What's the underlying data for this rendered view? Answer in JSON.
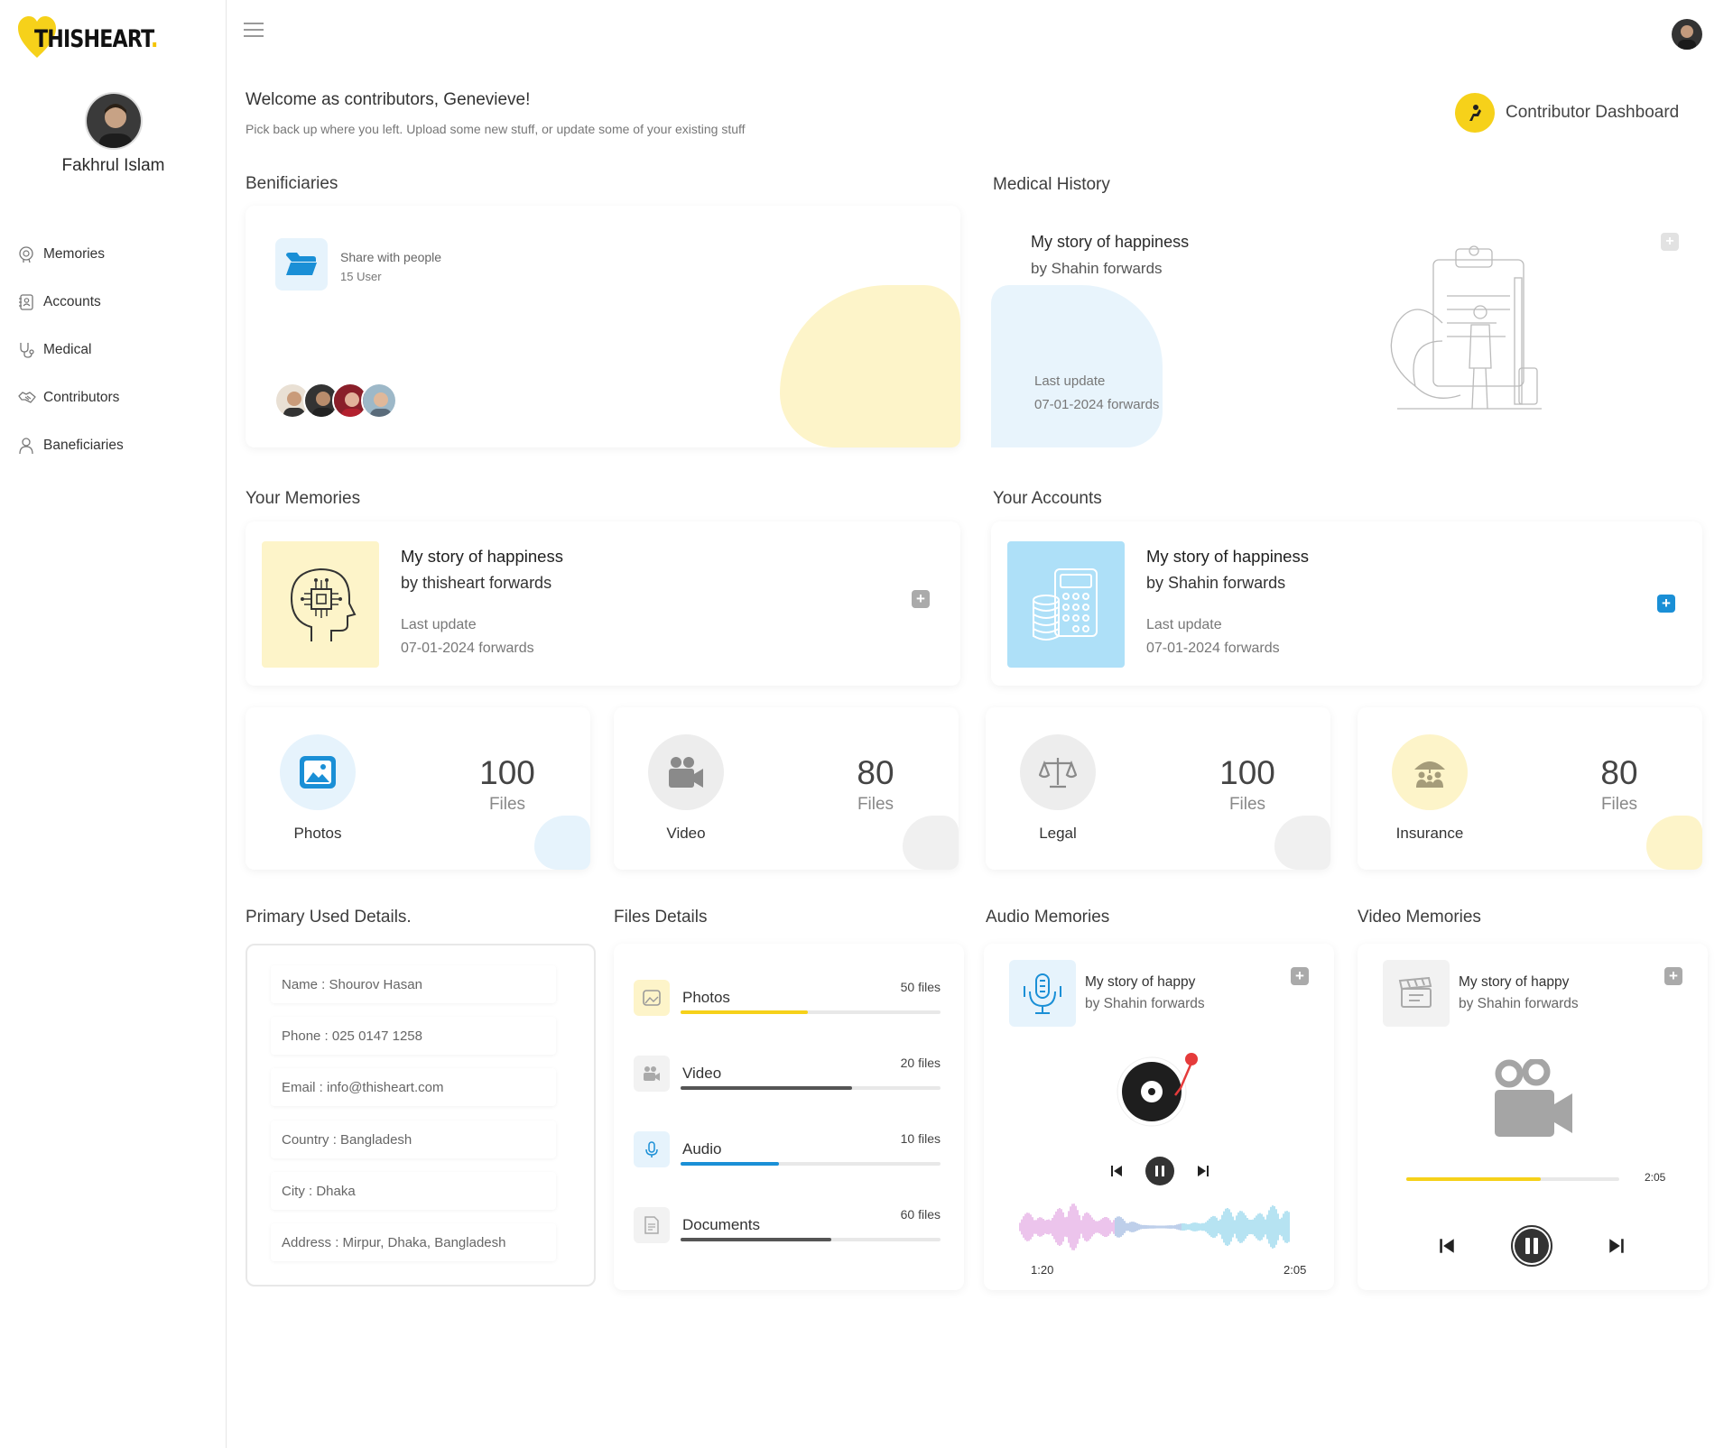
{
  "brand": {
    "name": "THISHEART",
    "accent": "#f6d11a"
  },
  "user": {
    "name": "Fakhrul Islam"
  },
  "nav": [
    {
      "label": "Memories",
      "icon": "brain-icon"
    },
    {
      "label": "Accounts",
      "icon": "contacts-book-icon"
    },
    {
      "label": "Medical",
      "icon": "stethoscope-icon"
    },
    {
      "label": "Contributors",
      "icon": "handshake-icon"
    },
    {
      "label": "Baneficiaries",
      "icon": "user-icon"
    }
  ],
  "welcome": {
    "title": "Welcome as contributors, Genevieve!",
    "subtitle": "Pick back up where you left. Upload some new stuff, or update some of your existing stuff"
  },
  "dashboard_label": "Contributor Dashboard",
  "sections": {
    "beneficiaries": "Benificiaries",
    "medical": "Medical History",
    "memories": "Your Memories",
    "accounts": "Your Accounts",
    "primary": "Primary Used  Details.",
    "files": "Files Details",
    "audio": "Audio Memories",
    "video": "Video Memories"
  },
  "beneficiaries": {
    "share": "Share with people",
    "users": "15 User"
  },
  "medical": {
    "title": "My story of happiness",
    "by": "by Shahin forwards",
    "last_label": "Last update",
    "date": "07-01-2024 forwards"
  },
  "memories_card": {
    "title": "My story of happiness",
    "by": "by thisheart forwards",
    "last_label": "Last update",
    "date": "07-01-2024 forwards"
  },
  "accounts_card": {
    "title": "My story of happiness",
    "by": "by Shahin forwards",
    "last_label": "Last update",
    "date": "07-01-2024 forwards"
  },
  "stats": [
    {
      "name": "Photos",
      "count": "100",
      "unit": "Files"
    },
    {
      "name": "Video",
      "count": "80",
      "unit": "Files"
    },
    {
      "name": "Legal",
      "count": "100",
      "unit": "Files"
    },
    {
      "name": "Insurance",
      "count": "80",
      "unit": "Files"
    }
  ],
  "primary": [
    "Name : Shourov Hasan",
    "Phone : 025 0147 1258",
    "Email : info@thisheart.com",
    "Country : Bangladesh",
    "City : Dhaka",
    "Address : Mirpur, Dhaka, Bangladesh"
  ],
  "files": [
    {
      "name": "Photos",
      "count": "50 files",
      "progress": 0.49,
      "color": "#f6d11a"
    },
    {
      "name": "Video",
      "count": "20 files",
      "progress": 0.66,
      "color": "#555555"
    },
    {
      "name": "Audio",
      "count": "10 files",
      "progress": 0.38,
      "color": "#1a8fd6"
    },
    {
      "name": "Documents",
      "count": "60 files",
      "progress": 0.58,
      "color": "#555555"
    }
  ],
  "audio": {
    "title": "My story of happy",
    "by": "by Shahin forwards",
    "current": "1:20",
    "total": "2:05"
  },
  "video": {
    "title": "My story of happy",
    "by": "by Shahin forwards",
    "total": "2:05",
    "progress": 0.63
  }
}
